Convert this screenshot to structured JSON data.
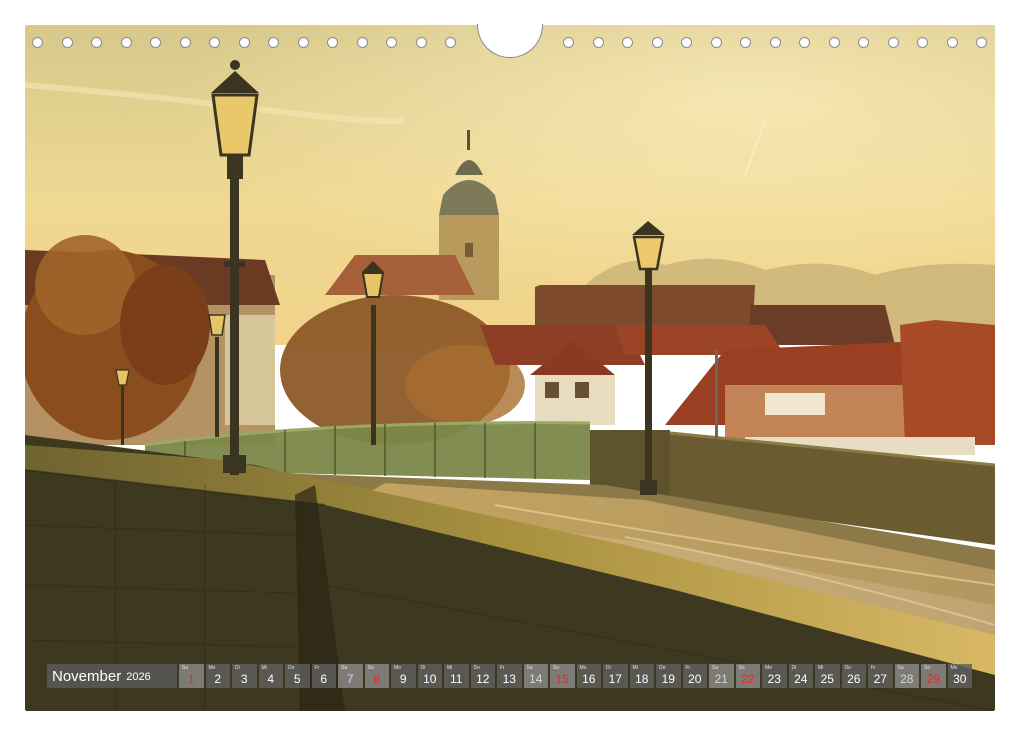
{
  "calendar": {
    "month": "November",
    "year": "2026",
    "days": [
      {
        "n": "1",
        "d": "So",
        "type": "sunday"
      },
      {
        "n": "2",
        "d": "Mo",
        "type": "weekday"
      },
      {
        "n": "3",
        "d": "Di",
        "type": "weekday"
      },
      {
        "n": "4",
        "d": "Mi",
        "type": "weekday"
      },
      {
        "n": "5",
        "d": "Do",
        "type": "weekday"
      },
      {
        "n": "6",
        "d": "Fr",
        "type": "weekday"
      },
      {
        "n": "7",
        "d": "Sa",
        "type": "saturday"
      },
      {
        "n": "8",
        "d": "So",
        "type": "sunday"
      },
      {
        "n": "9",
        "d": "Mo",
        "type": "weekday"
      },
      {
        "n": "10",
        "d": "Di",
        "type": "weekday"
      },
      {
        "n": "11",
        "d": "Mi",
        "type": "weekday"
      },
      {
        "n": "12",
        "d": "Do",
        "type": "weekday"
      },
      {
        "n": "13",
        "d": "Fr",
        "type": "weekday"
      },
      {
        "n": "14",
        "d": "Sa",
        "type": "saturday"
      },
      {
        "n": "15",
        "d": "So",
        "type": "sunday"
      },
      {
        "n": "16",
        "d": "Mo",
        "type": "weekday"
      },
      {
        "n": "17",
        "d": "Di",
        "type": "weekday"
      },
      {
        "n": "18",
        "d": "Mi",
        "type": "weekday"
      },
      {
        "n": "19",
        "d": "Do",
        "type": "weekday"
      },
      {
        "n": "20",
        "d": "Fr",
        "type": "weekday"
      },
      {
        "n": "21",
        "d": "Sa",
        "type": "saturday"
      },
      {
        "n": "22",
        "d": "So",
        "type": "sunday"
      },
      {
        "n": "23",
        "d": "Mo",
        "type": "weekday"
      },
      {
        "n": "24",
        "d": "Di",
        "type": "weekday"
      },
      {
        "n": "25",
        "d": "Mi",
        "type": "weekday"
      },
      {
        "n": "26",
        "d": "Do",
        "type": "weekday"
      },
      {
        "n": "27",
        "d": "Fr",
        "type": "weekday"
      },
      {
        "n": "28",
        "d": "Sa",
        "type": "saturday"
      },
      {
        "n": "29",
        "d": "So",
        "type": "sunday"
      },
      {
        "n": "30",
        "d": "Mo",
        "type": "weekday"
      }
    ]
  },
  "photo": {
    "subject": "stone-bridge-with-street-lamps-and-church-tower",
    "palette": {
      "sky_top": "#d9c98a",
      "sky_bottom": "#f3d68c",
      "haze": "#e8c57a",
      "wall_dark": "#3f3a22",
      "wall_light": "#8a7a3c",
      "roof": "#8a3a22",
      "foliage": "#7a4a1e",
      "railing": "#6c7a3a"
    }
  },
  "binding": {
    "hole_color": "#8a8a8a"
  }
}
